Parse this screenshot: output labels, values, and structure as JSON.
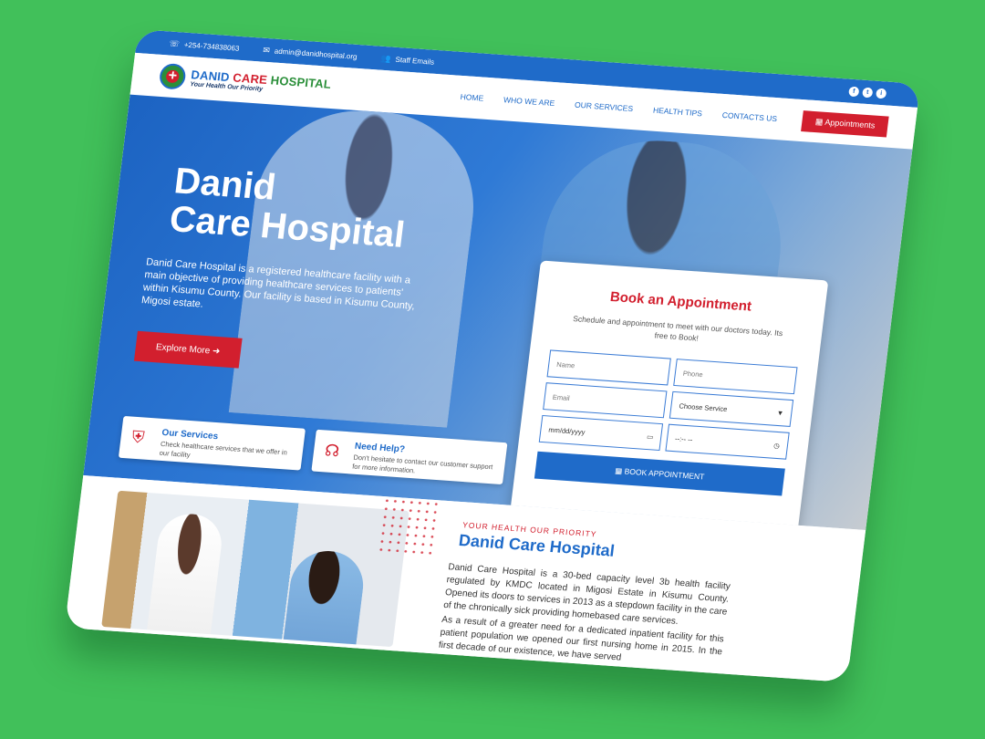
{
  "topbar": {
    "phone": "+254-734838063",
    "email": "admin@danidhospital.org",
    "staff": "Staff Emails",
    "social": [
      "f",
      "t",
      "i"
    ]
  },
  "brand": {
    "name_part1": "DANID",
    "name_part2": "CARE",
    "name_part3": "HOSPITAL",
    "tagline": "Your Health Our Priority"
  },
  "nav": {
    "items": [
      "HOME",
      "WHO WE ARE",
      "OUR SERVICES",
      "HEALTH TIPS",
      "CONTACTS US"
    ],
    "appointments_button": "Appointments"
  },
  "hero": {
    "title_line1": "Danid",
    "title_line2": "Care Hospital",
    "description": "Danid Care Hospital is a registered healthcare facility with a main objective of providing healthcare services to patients' within Kisumu County. Our  facility is based in Kisumu County, Migosi estate.",
    "explore_button": "Explore More"
  },
  "cards": [
    {
      "title": "Our Services",
      "text": "Check healthcare services that we offer in our facility"
    },
    {
      "title": "Need Help?",
      "text": "Don't hesitate to contact our customer support for more information."
    }
  ],
  "booking": {
    "title": "Book an Appointment",
    "subtitle": "Schedule and appointment to meet with our doctors  today. Its free to Book!",
    "name_placeholder": "Name",
    "phone_placeholder": "Phone",
    "email_placeholder": "Email",
    "service_select": "Choose Service",
    "date_placeholder": "mm/dd/yyyy",
    "time_placeholder": "--:-- --",
    "submit": "BOOK APPOINTMENT"
  },
  "about": {
    "kicker": "YOUR HEALTH OUR PRIORITY",
    "title": "Danid Care Hospital",
    "para1": "Danid Care Hospital is a 30-bed capacity level 3b health facility regulated by KMDC located in Migosi Estate in Kisumu County. Opened its doors to services in 2013 as a stepdown facility in the care of the chronically sick providing homebased care services.",
    "para2": "As a result of a greater need for a dedicated inpatient facility for this patient population we opened our first nursing home in 2015. In the first decade of our existence, we have served"
  },
  "colors": {
    "background": "#41c05a",
    "primary": "#1f6bc9",
    "accent": "#d21f2e"
  }
}
